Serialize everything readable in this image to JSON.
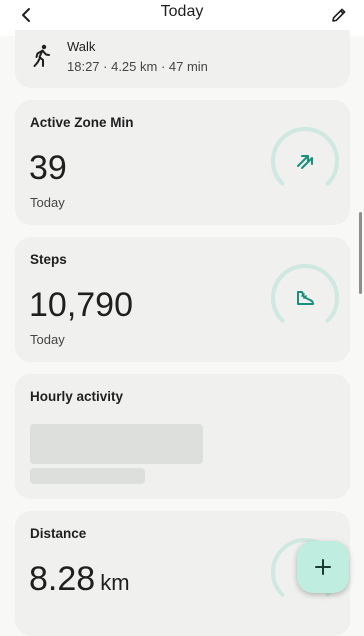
{
  "header": {
    "title": "Today"
  },
  "walk": {
    "title": "Walk",
    "details": "18:27 · 4.25 km · 47 min"
  },
  "active_zone": {
    "title": "Active Zone Min",
    "value": "39",
    "period": "Today",
    "ring_fraction": 0.75
  },
  "steps": {
    "title": "Steps",
    "value": "10,790",
    "period": "Today",
    "ring_fraction": 0.75
  },
  "hourly": {
    "title": "Hourly activity"
  },
  "distance": {
    "title": "Distance",
    "value": "8.28",
    "unit": "km"
  },
  "colors": {
    "accent": "#1a8f7c",
    "ring_track": "#cfe8e2",
    "fab": "#bfeee0"
  },
  "icons": {
    "back": "chevron-left-icon",
    "edit": "pencil-icon",
    "walk": "walking-person-icon",
    "active_zone": "active-zone-arrows-icon",
    "steps": "shoe-icon",
    "add": "plus-icon"
  }
}
